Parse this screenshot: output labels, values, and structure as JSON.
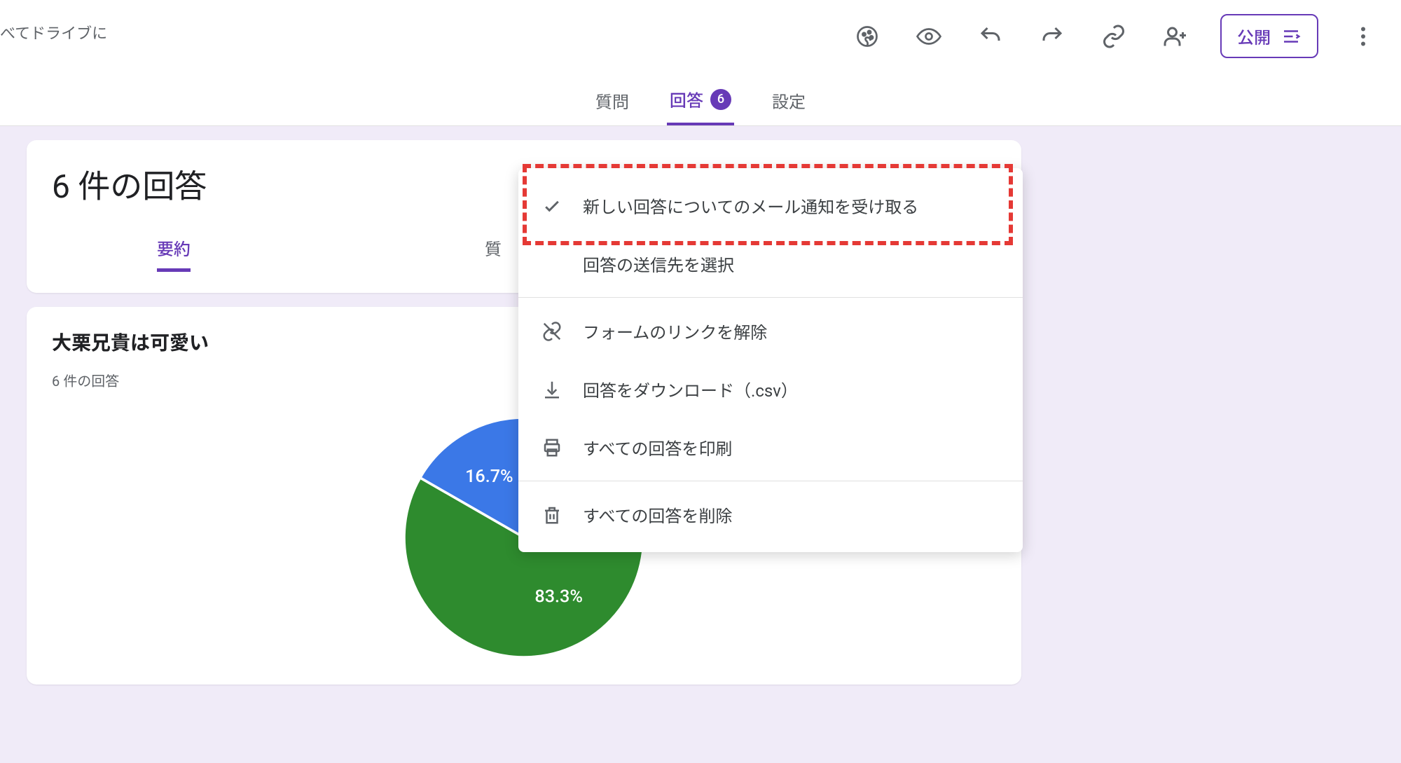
{
  "topbar": {
    "drive_status": "べてドライブに",
    "publish_label": "公開"
  },
  "tabs": {
    "questions": "質問",
    "responses": "回答",
    "settings": "設定",
    "response_count": "6"
  },
  "responses_card": {
    "title": "6 件の回答",
    "sub_summary": "要約",
    "sub_question_prefix": "質"
  },
  "question_card": {
    "title": "大栗兄貴は可愛い",
    "subtitle": "6 件の回答"
  },
  "menu": {
    "email_notify": "新しい回答についてのメール通知を受け取る",
    "select_dest": "回答の送信先を選択",
    "unlink_form": "フォームのリンクを解除",
    "download_csv": "回答をダウンロード（.csv）",
    "print_all": "すべての回答を印刷",
    "delete_all": "すべての回答を削除"
  },
  "chart_data": {
    "type": "pie",
    "title": "大栗兄貴は可愛い",
    "slices": [
      {
        "label": "83.3%",
        "value": 83.3,
        "color": "#2e8b2e"
      },
      {
        "label": "16.7%",
        "value": 16.7,
        "color": "#3b78e7"
      }
    ]
  }
}
